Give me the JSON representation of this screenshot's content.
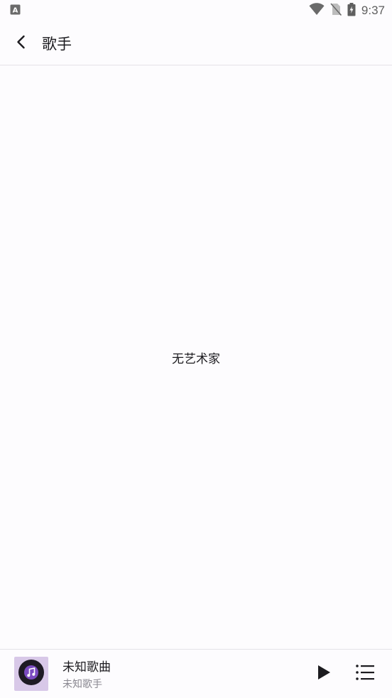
{
  "status_bar": {
    "time": "9:37",
    "icons": [
      "keyboard-a-icon",
      "wifi-icon",
      "no-sim-icon",
      "battery-charging-icon"
    ]
  },
  "app_bar": {
    "title": "歌手",
    "back_icon": "back-arrow-icon"
  },
  "empty_state": {
    "message": "无艺术家"
  },
  "mini_player": {
    "song_title": "未知歌曲",
    "artist": "未知歌手",
    "play_icon": "play-icon",
    "playlist_icon": "playlist-icon"
  },
  "colors": {
    "background": "#fdfcfe",
    "divider": "#e4e2e7",
    "cover_bg": "#d8c8e8",
    "disc": "#1e1b24",
    "disc_accent": "#7b4bc0",
    "text_primary": "#1c1b1f",
    "text_secondary": "#8a8891"
  }
}
